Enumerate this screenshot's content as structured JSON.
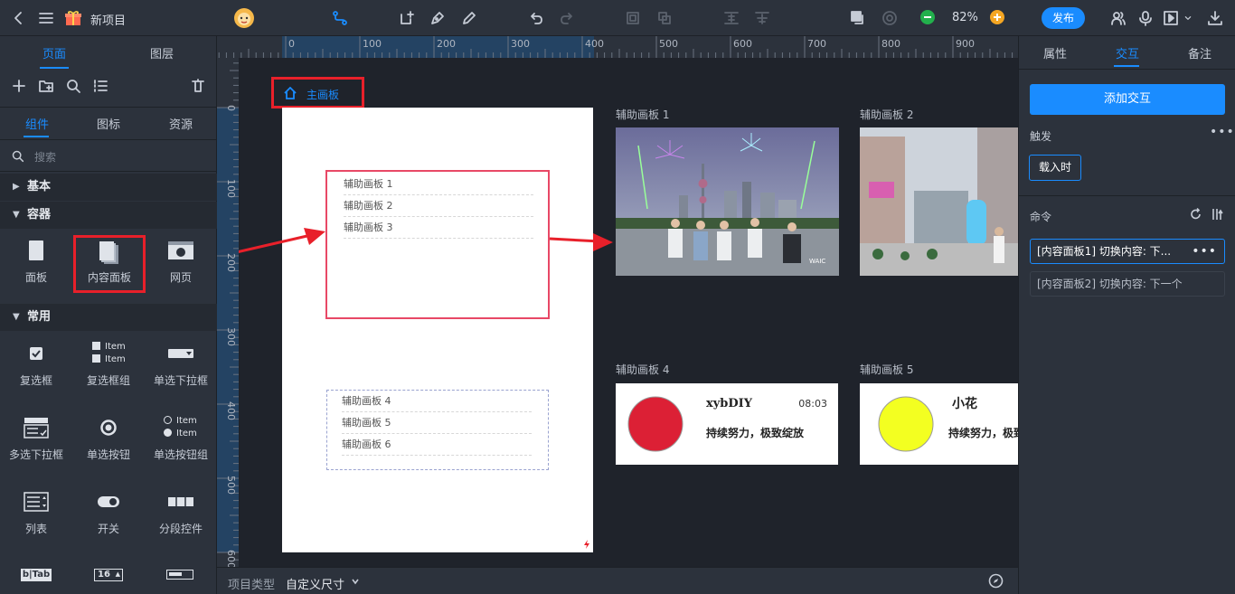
{
  "topbar": {
    "project_name": "新项目",
    "zoom": "82%",
    "publish_label": "发布"
  },
  "left_panel": {
    "tabs": [
      "页面",
      "图层"
    ],
    "subtabs": [
      "组件",
      "图标",
      "资源"
    ],
    "search_placeholder": "搜索",
    "sections": {
      "basic": "基本",
      "container": "容器",
      "common": "常用"
    },
    "container_items": [
      "面板",
      "内容面板",
      "网页"
    ],
    "common_items": [
      "复选框",
      "复选框组",
      "单选下拉框",
      "多选下拉框",
      "单选按钮",
      "单选按钮组",
      "列表",
      "开关",
      "分段控件"
    ],
    "item_text": "Item",
    "stepper_value": "16",
    "tab_icon_text": "b|Tab"
  },
  "ruler": {
    "top": [
      "0",
      "100",
      "200",
      "300",
      "400",
      "500",
      "600",
      "700",
      "800",
      "900"
    ],
    "left": [
      "0",
      "100",
      "200",
      "300",
      "400",
      "500",
      "600"
    ]
  },
  "canvas": {
    "main_artboard_label": "主画板",
    "content_panel_1": [
      "辅助画板 1",
      "辅助画板 2",
      "辅助画板 3"
    ],
    "content_panel_2": [
      "辅助画板 4",
      "辅助画板 5",
      "辅助画板 6"
    ],
    "aux_boards": [
      "辅助画板 1",
      "辅助画板 2",
      "辅助画板 4",
      "辅助画板 5"
    ],
    "card4": {
      "name": "xybDIY",
      "time": "08:03",
      "text": "持续努力，极致绽放",
      "circle_color": "#dc2035"
    },
    "card5": {
      "name": "小花",
      "text": "持续努力，极致绽放",
      "circle_color": "#f3ff21"
    },
    "highlight_color": "#e8202a",
    "photo1_watermark": "WAIC"
  },
  "statusbar": {
    "project_type_label": "项目类型",
    "project_type_value": "自定义尺寸"
  },
  "right_panel": {
    "tabs": [
      "属性",
      "交互",
      "备注"
    ],
    "add_interaction": "添加交互",
    "trigger_label": "触发",
    "trigger_value": "载入时",
    "command_label": "命令",
    "commands": [
      "[内容面板1] 切换内容: 下...",
      "[内容面板2] 切换内容: 下一个"
    ]
  }
}
